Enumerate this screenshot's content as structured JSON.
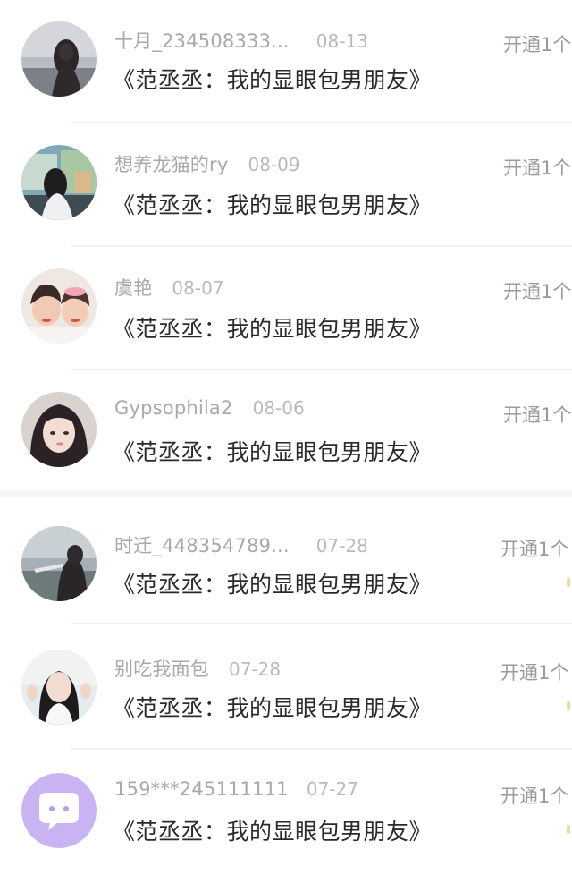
{
  "comments": [
    {
      "user": "十月_234508333...",
      "date": "08-13",
      "work": "《范丞丞：我的显眼包男朋友》",
      "action": "开通1个",
      "avatar": "woman-dark-hair-avatar"
    },
    {
      "user": "想养龙猫的ry",
      "date": "08-09",
      "work": "《范丞丞：我的显眼包男朋友》",
      "action": "开通1个",
      "avatar": "girl-window-avatar"
    },
    {
      "user": "虞艳",
      "date": "08-07",
      "work": "《范丞丞：我的显眼包男朋友》",
      "action": "开通1个",
      "avatar": "two-girls-avatar"
    },
    {
      "user": "Gypsophila2",
      "date": "08-06",
      "work": "《范丞丞：我的显眼包男朋友》",
      "action": "开通1个",
      "avatar": "girl-portrait-avatar"
    },
    {
      "user": "时迁_448354789...",
      "date": "07-28",
      "work": "《范丞丞：我的显眼包男朋友》",
      "action": "开通1个",
      "avatar": "woman-landscape-avatar"
    },
    {
      "user": "别吃我面包",
      "date": "07-28",
      "work": "《范丞丞：我的显眼包男朋友》",
      "action": "开通1个",
      "avatar": "girl-waving-avatar"
    },
    {
      "user": "159***245111111",
      "date": "07-27",
      "work": "《范丞丞：我的显眼包男朋友》",
      "action": "开通1个",
      "avatar": "default-chat-avatar"
    }
  ]
}
